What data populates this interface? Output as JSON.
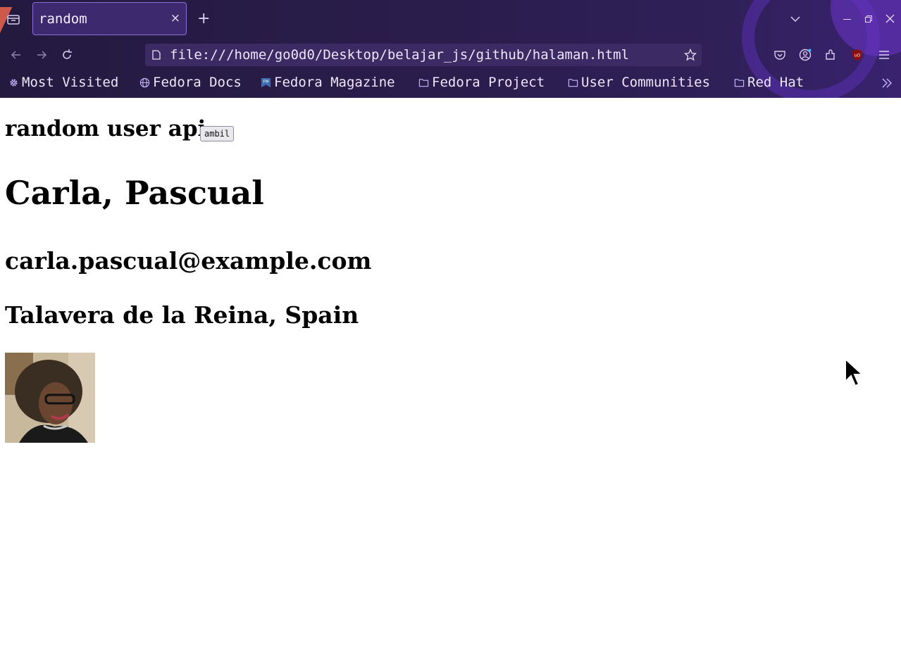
{
  "tab": {
    "title": "random",
    "close": "×",
    "new_tab": "+"
  },
  "urlbar": {
    "url": "file:///home/go0d0/Desktop/belajar_js/github/halaman.html"
  },
  "bookmarks": [
    {
      "label": "Most Visited",
      "icon": "gear-icon"
    },
    {
      "label": "Fedora Docs",
      "icon": "globe-icon"
    },
    {
      "label": "Fedora Magazine",
      "icon": "fm-icon"
    },
    {
      "label": "Fedora Project",
      "icon": "folder-icon"
    },
    {
      "label": "User Communities",
      "icon": "folder-icon"
    },
    {
      "label": "Red Hat",
      "icon": "folder-icon"
    }
  ],
  "page": {
    "heading": "random user api",
    "button_label": "ambil",
    "name": "Carla, Pascual",
    "email": "carla.pascual@example.com",
    "location": "Talavera de la Reina, Spain"
  },
  "colors": {
    "chrome": "#2a1d4c",
    "urlbar": "#3b2a63",
    "accent": "#8a6fd6"
  }
}
